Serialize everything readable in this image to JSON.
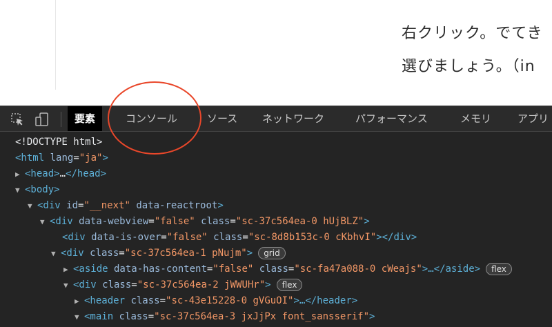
{
  "article": {
    "lines": [
      "",
      "右クリック。でてき",
      "選びましょう。（in"
    ]
  },
  "devtools": {
    "tabs": [
      {
        "label": "要素",
        "active": true
      },
      {
        "label": "コンソール",
        "active": false
      },
      {
        "label": "ソース",
        "active": false
      },
      {
        "label": "ネットワーク",
        "active": false
      },
      {
        "label": "パフォーマンス",
        "active": false
      },
      {
        "label": "メモリ",
        "active": false
      },
      {
        "label": "アプリ",
        "active": false
      }
    ],
    "icons": [
      "inspect-element-icon",
      "device-toolbar-icon"
    ]
  },
  "tree": {
    "r0": {
      "text": "<!DOCTYPE html>"
    },
    "r1": {
      "t1": "<html",
      "a1": " lang",
      "v1": "\"ja\"",
      "t2": ">"
    },
    "r2": {
      "t1": "<head>",
      "p1": "…",
      "t2": "</head>"
    },
    "r3": {
      "t1": "<body>"
    },
    "r4": {
      "t1": "<div",
      "a1": " id",
      "v1": "\"__next\"",
      "a2": " data-reactroot",
      "t2": ">"
    },
    "r5": {
      "t1": "<div",
      "a1": " data-webview",
      "v1": "\"false\"",
      "a2": " class",
      "v2": "\"sc-37c564ea-0 hUjBLZ\"",
      "t2": ">"
    },
    "r6": {
      "t1": "<div",
      "a1": " data-is-over",
      "v1": "\"false\"",
      "a2": " class",
      "v2": "\"sc-8d8b153c-0 cKbhvI\"",
      "t2": "></div>"
    },
    "r7": {
      "t1": "<div",
      "a1": " class",
      "v1": "\"sc-37c564ea-1 pNujm\"",
      "t2": ">",
      "badge": "grid"
    },
    "r8": {
      "t1": "<aside",
      "a1": " data-has-content",
      "v1": "\"false\"",
      "a2": " class",
      "v2": "\"sc-fa47a088-0 cWeajs\"",
      "t2": ">…</aside>",
      "badge": "flex"
    },
    "r9": {
      "t1": "<div",
      "a1": " class",
      "v1": "\"sc-37c564ea-2 jWWUHr\"",
      "t2": ">",
      "badge": "flex"
    },
    "r10": {
      "t1": "<header",
      "a1": " class",
      "v1": "\"sc-43e15228-0 gVGuOI\"",
      "t2": ">…</header>"
    },
    "r11": {
      "t1": "<main",
      "a1": " class",
      "v1": "\"sc-37c564ea-3 jxJjPx font_sansserif\"",
      "t2": ">"
    }
  },
  "arrows": {
    "expanded": "▼",
    "collapsed": "▶"
  },
  "colors": {
    "annotation": "#e9472a",
    "tag": "#5db0d7",
    "attr_value": "#f29766",
    "attr_name": "#9bbbdc"
  }
}
